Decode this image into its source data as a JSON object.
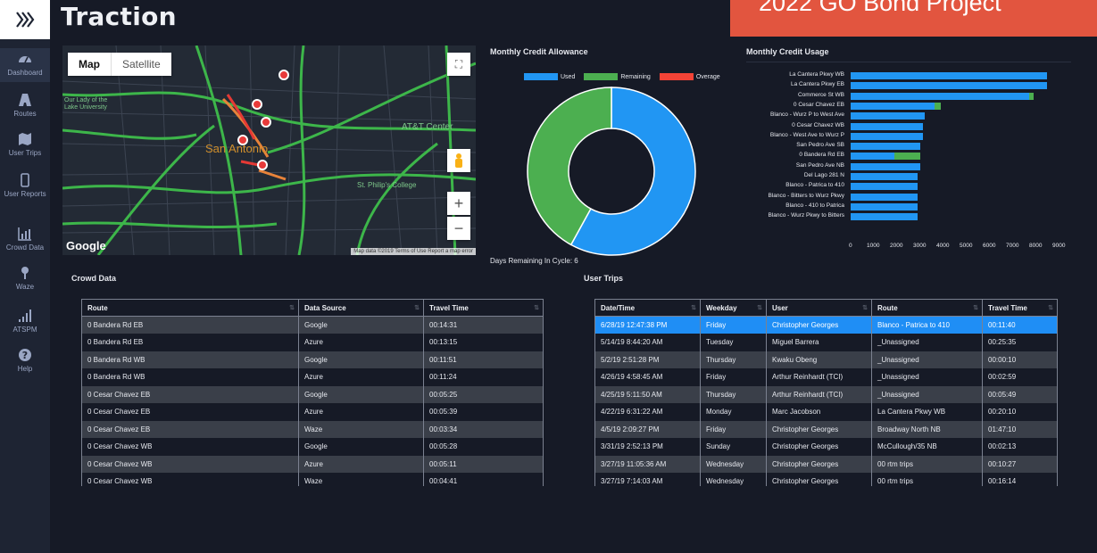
{
  "app": {
    "title": "Traction",
    "banner": "2022 GO Bond Project"
  },
  "sidebar": {
    "items": [
      {
        "label": "Dashboard",
        "icon": "dashboard-icon"
      },
      {
        "label": "Routes",
        "icon": "road-icon"
      },
      {
        "label": "User Trips",
        "icon": "map-icon"
      },
      {
        "label": "User Reports",
        "icon": "mobile-icon"
      },
      {
        "label": "Crowd Data",
        "icon": "bar-chart-icon"
      },
      {
        "label": "Waze",
        "icon": "pin-icon"
      },
      {
        "label": "ATSPM",
        "icon": "signal-icon"
      },
      {
        "label": "Help",
        "icon": "help-icon"
      }
    ]
  },
  "map": {
    "tab_map": "Map",
    "tab_satellite": "Satellite",
    "labels": [
      "San Antonio",
      "AT&T Center",
      "St. Philip's College",
      "Our Lady of the Lake University"
    ],
    "google": "Google",
    "attribution": "Map data ©2019  Terms of Use  Report a map error",
    "zoom_in": "+",
    "zoom_out": "−"
  },
  "allowance": {
    "title": "Monthly Credit Allowance",
    "legend": [
      {
        "label": "Used",
        "color": "#2196f3"
      },
      {
        "label": "Remaining",
        "color": "#4caf50"
      },
      {
        "label": "Overage",
        "color": "#f44336"
      }
    ],
    "days_remaining": "Days Remaining In Cycle: 6",
    "chart_data": {
      "type": "pie",
      "labels": [
        "Used",
        "Remaining",
        "Overage"
      ],
      "values": [
        58,
        42,
        0
      ]
    }
  },
  "usage": {
    "title": "Monthly Credit Usage",
    "chart_data": {
      "type": "bar",
      "orientation": "horizontal",
      "categories": [
        "La Cantera Pkwy WB",
        "La Cantera Pkwy EB",
        "Commerce St WB",
        "0 Cesar Chavez EB",
        "Blanco - Wurz P to West Ave",
        "0 Cesar Chavez WB",
        "Blanco - West Ave to Wurz P",
        "San Pedro Ave SB",
        "0 Bandera Rd EB",
        "San Pedro Ave NB",
        "Del Lago 281 N",
        "Blanco - Patrica to 410",
        "Blanco - Bitters to Wurz Pkwy",
        "Blanco - 410 to Patrica",
        "Blanco - Wurz Pkwy to Bitters"
      ],
      "series": [
        {
          "color": "#2196f3",
          "values": [
            8450,
            8450,
            7700,
            3600,
            3200,
            3100,
            3100,
            3000,
            1900,
            3000,
            2900,
            2900,
            2900,
            2900,
            2900
          ]
        },
        {
          "color": "#4caf50",
          "values": [
            0,
            0,
            200,
            300,
            0,
            0,
            0,
            0,
            1100,
            0,
            0,
            0,
            0,
            0,
            0
          ]
        }
      ],
      "xlim": [
        0,
        9000
      ],
      "xticks": [
        "0",
        "1000",
        "2000",
        "3000",
        "4000",
        "5000",
        "6000",
        "7000",
        "8000",
        "9000"
      ]
    }
  },
  "crowd": {
    "title": "Crowd Data",
    "columns": [
      "Route",
      "Data Source",
      "Travel Time"
    ],
    "rows": [
      [
        "0 Bandera Rd EB",
        "Google",
        "00:14:31"
      ],
      [
        "0 Bandera Rd EB",
        "Azure",
        "00:13:15"
      ],
      [
        "0 Bandera Rd WB",
        "Google",
        "00:11:51"
      ],
      [
        "0 Bandera Rd WB",
        "Azure",
        "00:11:24"
      ],
      [
        "0 Cesar Chavez EB",
        "Google",
        "00:05:25"
      ],
      [
        "0 Cesar Chavez EB",
        "Azure",
        "00:05:39"
      ],
      [
        "0 Cesar Chavez EB",
        "Waze",
        "00:03:34"
      ],
      [
        "0 Cesar Chavez WB",
        "Google",
        "00:05:28"
      ],
      [
        "0 Cesar Chavez WB",
        "Azure",
        "00:05:11"
      ],
      [
        "0 Cesar Chavez WB",
        "Waze",
        "00:04:41"
      ]
    ]
  },
  "trips": {
    "title": "User Trips",
    "columns": [
      "Date/Time",
      "Weekday",
      "User",
      "Route",
      "Travel Time"
    ],
    "rows": [
      [
        "6/28/19 12:47:38 PM",
        "Friday",
        "Christopher Georges",
        "Blanco - Patrica to 410",
        "00:11:40"
      ],
      [
        "5/14/19 8:44:20 AM",
        "Tuesday",
        "Miguel Barrera",
        "_Unassigned",
        "00:25:35"
      ],
      [
        "5/2/19 2:51:28 PM",
        "Thursday",
        "Kwaku Obeng",
        "_Unassigned",
        "00:00:10"
      ],
      [
        "4/26/19 4:58:45 AM",
        "Friday",
        "Arthur Reinhardt (TCI)",
        "_Unassigned",
        "00:02:59"
      ],
      [
        "4/25/19 5:11:50 AM",
        "Thursday",
        "Arthur Reinhardt (TCI)",
        "_Unassigned",
        "00:05:49"
      ],
      [
        "4/22/19 6:31:22 AM",
        "Monday",
        "Marc Jacobson",
        "La Cantera Pkwy WB",
        "00:20:10"
      ],
      [
        "4/5/19 2:09:27 PM",
        "Friday",
        "Christopher Georges",
        "Broadway North NB",
        "01:47:10"
      ],
      [
        "3/31/19 2:52:13 PM",
        "Sunday",
        "Christopher Georges",
        "McCullough/35 NB",
        "00:02:13"
      ],
      [
        "3/27/19 11:05:36 AM",
        "Wednesday",
        "Christopher Georges",
        "00 rtm trips",
        "00:10:27"
      ],
      [
        "3/27/19 7:14:03 AM",
        "Wednesday",
        "Christopher Georges",
        "00 rtm trips",
        "00:16:14"
      ]
    ]
  }
}
